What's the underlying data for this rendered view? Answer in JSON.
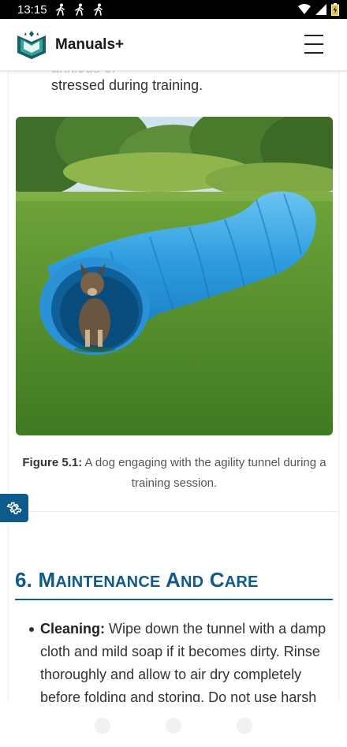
{
  "status_bar": {
    "time": "13:15"
  },
  "header": {
    "logo_text": "Manuals+"
  },
  "content": {
    "prev_text_faded": "anxious or",
    "prev_text": "stressed during training.",
    "figure": {
      "caption_label": "Figure 5.1:",
      "caption_text": " A dog engaging with the agility tunnel during a training session."
    },
    "section": {
      "number": "6.",
      "title_words": [
        {
          "cap": "M",
          "rest": "AINTENANCE"
        },
        {
          "cap": "A",
          "rest": "ND"
        },
        {
          "cap": "C",
          "rest": "ARE"
        }
      ]
    },
    "bullets": [
      {
        "label": "Cleaning:",
        "text": " Wipe down the tunnel with a damp cloth and mild soap if it becomes dirty. Rinse thoroughly and allow to air dry completely before folding and storing. Do not use harsh"
      }
    ]
  },
  "colors": {
    "accent": "#0e5a8a",
    "tunnel": "#2d9de0",
    "grass": "#4a8a2a"
  },
  "icons": [
    "walking-icon",
    "wifi-icon",
    "signal-icon",
    "battery-icon",
    "manuals-logo-icon",
    "menu-icon",
    "gear-icon"
  ]
}
